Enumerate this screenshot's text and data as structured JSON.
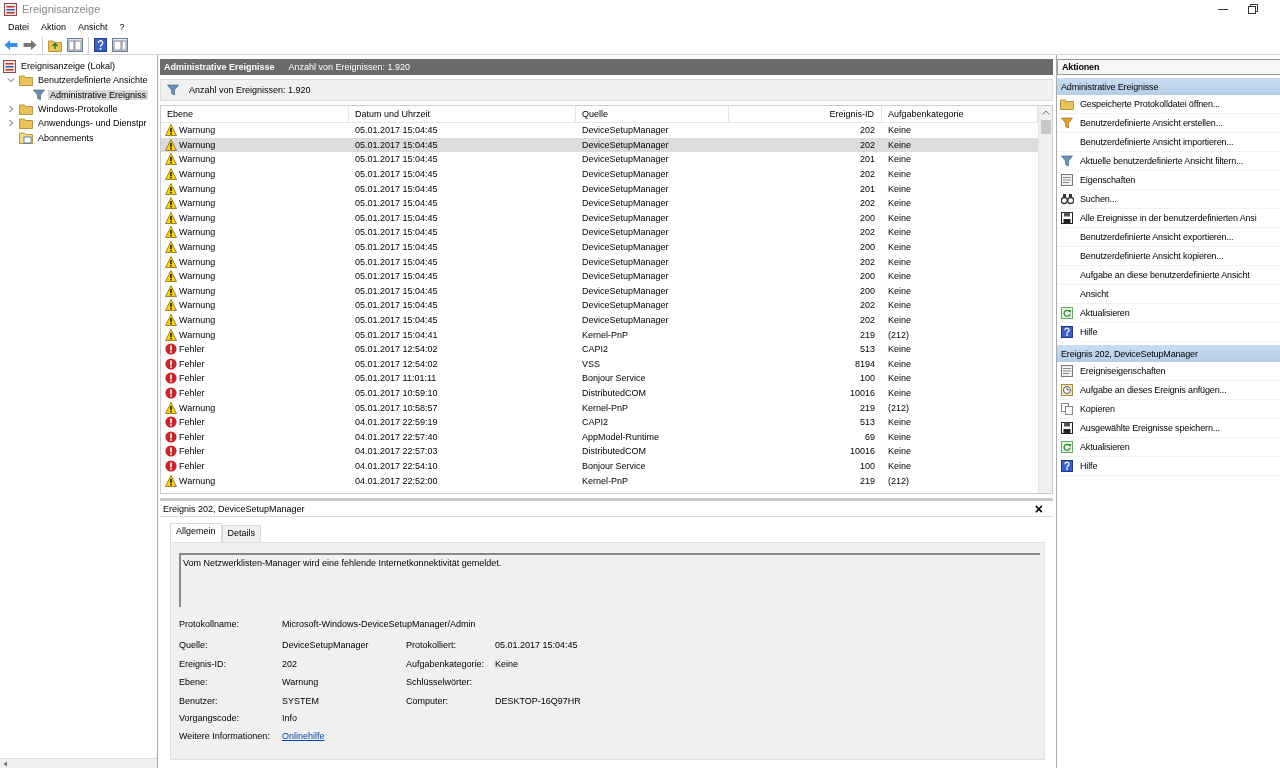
{
  "window": {
    "title": "Ereignisanzeige"
  },
  "menu": [
    "Datei",
    "Aktion",
    "Ansicht",
    "?"
  ],
  "tree": [
    {
      "label": "Ereignisanzeige (Lokal)",
      "kind": "viewer",
      "selected": false,
      "children": [
        {
          "label": "Benutzerdefinierte Ansichte",
          "kind": "folder",
          "expanded": true,
          "selected": false,
          "children": [
            {
              "label": "Administrative Ereigniss",
              "kind": "filter",
              "selected": true
            }
          ]
        },
        {
          "label": "Windows-Protokolle",
          "kind": "folder",
          "expanded": false,
          "selected": false
        },
        {
          "label": "Anwendungs- und Dienstpr",
          "kind": "folder",
          "expanded": false,
          "selected": false
        },
        {
          "label": "Abonnements",
          "kind": "subscription",
          "selected": false
        }
      ]
    }
  ],
  "view": {
    "title": "Administrative Ereignisse",
    "count": "Anzahl von Ereignissen: 1.920",
    "filter_text": "Anzahl von Ereignissen: 1.920"
  },
  "table": {
    "columns": [
      "Ebene",
      "Datum und Uhrzeit",
      "Quelle",
      "Ereignis-ID",
      "Aufgabenkategorie"
    ],
    "rows": [
      {
        "kind": "warning",
        "level": "Warnung",
        "date": "05.01.2017 15:04:45",
        "source": "DeviceSetupManager",
        "id": "202",
        "category": "Keine",
        "selected": false
      },
      {
        "kind": "warning",
        "level": "Warnung",
        "date": "05.01.2017 15:04:45",
        "source": "DeviceSetupManager",
        "id": "202",
        "category": "Keine",
        "selected": true
      },
      {
        "kind": "warning",
        "level": "Warnung",
        "date": "05.01.2017 15:04:45",
        "source": "DeviceSetupManager",
        "id": "201",
        "category": "Keine",
        "selected": false
      },
      {
        "kind": "warning",
        "level": "Warnung",
        "date": "05.01.2017 15:04:45",
        "source": "DeviceSetupManager",
        "id": "202",
        "category": "Keine",
        "selected": false
      },
      {
        "kind": "warning",
        "level": "Warnung",
        "date": "05.01.2017 15:04:45",
        "source": "DeviceSetupManager",
        "id": "201",
        "category": "Keine",
        "selected": false
      },
      {
        "kind": "warning",
        "level": "Warnung",
        "date": "05.01.2017 15:04:45",
        "source": "DeviceSetupManager",
        "id": "202",
        "category": "Keine",
        "selected": false
      },
      {
        "kind": "warning",
        "level": "Warnung",
        "date": "05.01.2017 15:04:45",
        "source": "DeviceSetupManager",
        "id": "200",
        "category": "Keine",
        "selected": false
      },
      {
        "kind": "warning",
        "level": "Warnung",
        "date": "05.01.2017 15:04:45",
        "source": "DeviceSetupManager",
        "id": "202",
        "category": "Keine",
        "selected": false
      },
      {
        "kind": "warning",
        "level": "Warnung",
        "date": "05.01.2017 15:04:45",
        "source": "DeviceSetupManager",
        "id": "200",
        "category": "Keine",
        "selected": false
      },
      {
        "kind": "warning",
        "level": "Warnung",
        "date": "05.01.2017 15:04:45",
        "source": "DeviceSetupManager",
        "id": "202",
        "category": "Keine",
        "selected": false
      },
      {
        "kind": "warning",
        "level": "Warnung",
        "date": "05.01.2017 15:04:45",
        "source": "DeviceSetupManager",
        "id": "200",
        "category": "Keine",
        "selected": false
      },
      {
        "kind": "warning",
        "level": "Warnung",
        "date": "05.01.2017 15:04:45",
        "source": "DeviceSetupManager",
        "id": "200",
        "category": "Keine",
        "selected": false
      },
      {
        "kind": "warning",
        "level": "Warnung",
        "date": "05.01.2017 15:04:45",
        "source": "DeviceSetupManager",
        "id": "202",
        "category": "Keine",
        "selected": false
      },
      {
        "kind": "warning",
        "level": "Warnung",
        "date": "05.01.2017 15:04:45",
        "source": "DeviceSetupManager",
        "id": "202",
        "category": "Keine",
        "selected": false
      },
      {
        "kind": "warning",
        "level": "Warnung",
        "date": "05.01.2017 15:04:41",
        "source": "Kernel-PnP",
        "id": "219",
        "category": "(212)",
        "selected": false
      },
      {
        "kind": "error",
        "level": "Fehler",
        "date": "05.01.2017 12:54:02",
        "source": "CAPI2",
        "id": "513",
        "category": "Keine",
        "selected": false
      },
      {
        "kind": "error",
        "level": "Fehler",
        "date": "05.01.2017 12:54:02",
        "source": "VSS",
        "id": "8194",
        "category": "Keine",
        "selected": false
      },
      {
        "kind": "error",
        "level": "Fehler",
        "date": "05.01.2017 11:01:11",
        "source": "Bonjour Service",
        "id": "100",
        "category": "Keine",
        "selected": false
      },
      {
        "kind": "error",
        "level": "Fehler",
        "date": "05.01.2017 10:59:10",
        "source": "DistributedCOM",
        "id": "10016",
        "category": "Keine",
        "selected": false
      },
      {
        "kind": "warning",
        "level": "Warnung",
        "date": "05.01.2017 10:58:57",
        "source": "Kernel-PnP",
        "id": "219",
        "category": "(212)",
        "selected": false
      },
      {
        "kind": "error",
        "level": "Fehler",
        "date": "04.01.2017 22:59:19",
        "source": "CAPI2",
        "id": "513",
        "category": "Keine",
        "selected": false
      },
      {
        "kind": "error",
        "level": "Fehler",
        "date": "04.01.2017 22:57:40",
        "source": "AppModel-Runtime",
        "id": "69",
        "category": "Keine",
        "selected": false
      },
      {
        "kind": "error",
        "level": "Fehler",
        "date": "04.01.2017 22:57:03",
        "source": "DistributedCOM",
        "id": "10016",
        "category": "Keine",
        "selected": false
      },
      {
        "kind": "error",
        "level": "Fehler",
        "date": "04.01.2017 22:54:10",
        "source": "Bonjour Service",
        "id": "100",
        "category": "Keine",
        "selected": false
      },
      {
        "kind": "warning",
        "level": "Warnung",
        "date": "04.01.2017 22:52:00",
        "source": "Kernel-PnP",
        "id": "219",
        "category": "(212)",
        "selected": false
      }
    ]
  },
  "detail": {
    "title": "Ereignis 202, DeviceSetupManager",
    "close": "×",
    "tabs": [
      {
        "label": "Allgemein",
        "selected": true
      },
      {
        "label": "Details",
        "selected": false
      }
    ],
    "message": "Vom Netzwerklisten-Manager wird eine fehlende Internetkonnektivität gemeldet.",
    "fields": [
      {
        "left": {
          "label": "Protokollname:",
          "value": "Microsoft-Windows-DeviceSetupManager/Admin"
        }
      },
      {
        "left": {
          "label": "Quelle:",
          "value": "DeviceSetupManager"
        },
        "right": {
          "label": "Protokolliert:",
          "value": "05.01.2017 15:04:45"
        }
      },
      {
        "left": {
          "label": "Ereignis-ID:",
          "value": "202"
        },
        "right": {
          "label": "Aufgabenkategorie:",
          "value": "Keine"
        }
      },
      {
        "left": {
          "label": "Ebene:",
          "value": "Warnung"
        },
        "right": {
          "label": "Schlüsselwörter:"
        }
      },
      {
        "left": {
          "label": "Benutzer:",
          "value": "SYSTEM"
        },
        "right": {
          "label": "Computer:",
          "value": "DESKTOP-16Q97HR"
        }
      },
      {
        "left": {
          "label": "Vorgangscode:",
          "value": "Info"
        }
      },
      {
        "left": {
          "label": "Weitere Informationen:",
          "value": "Onlinehilfe",
          "kind": "link"
        }
      }
    ]
  },
  "actions": {
    "title": "Aktionen",
    "sections": [
      {
        "title": "Administrative Ereignisse",
        "items": [
          {
            "label": "Gespeicherte Protokolldatei öffnen...",
            "kind": "folder"
          },
          {
            "label": "Benutzerdefinierte Ansicht erstellen...",
            "kind": "filter-new"
          },
          {
            "label": "Benutzerdefinierte Ansicht importieren...",
            "kind": "none"
          },
          {
            "label": "Aktuelle benutzerdefinierte Ansicht filtern...",
            "kind": "filter"
          },
          {
            "label": "Eigenschaften",
            "kind": "properties"
          },
          {
            "label": "Suchen...",
            "kind": "binoculars"
          },
          {
            "label": "Alle Ereignisse in der benutzerdefinierten Ansi",
            "kind": "save"
          },
          {
            "label": "Benutzerdefinierte Ansicht exportieren...",
            "kind": "none"
          },
          {
            "label": "Benutzerdefinierte Ansicht kopieren...",
            "kind": "none"
          },
          {
            "label": "Aufgabe an diese benutzerdefinierte Ansicht",
            "kind": "none"
          },
          {
            "label": "Ansicht",
            "kind": "none"
          },
          {
            "label": "Aktualisieren",
            "kind": "refresh"
          },
          {
            "label": "Hilfe",
            "kind": "help"
          }
        ]
      },
      {
        "title": "Ereignis 202, DeviceSetupManager",
        "items": [
          {
            "label": "Ereigniseigenschaften",
            "kind": "properties"
          },
          {
            "label": "Aufgabe an dieses Ereignis anfügen...",
            "kind": "clock"
          },
          {
            "label": "Kopieren",
            "kind": "copy"
          },
          {
            "label": "Ausgewählte Ereignisse speichern...",
            "kind": "save"
          },
          {
            "label": "Aktualisieren",
            "kind": "refresh"
          },
          {
            "label": "Hilfe",
            "kind": "help"
          }
        ]
      }
    ]
  }
}
